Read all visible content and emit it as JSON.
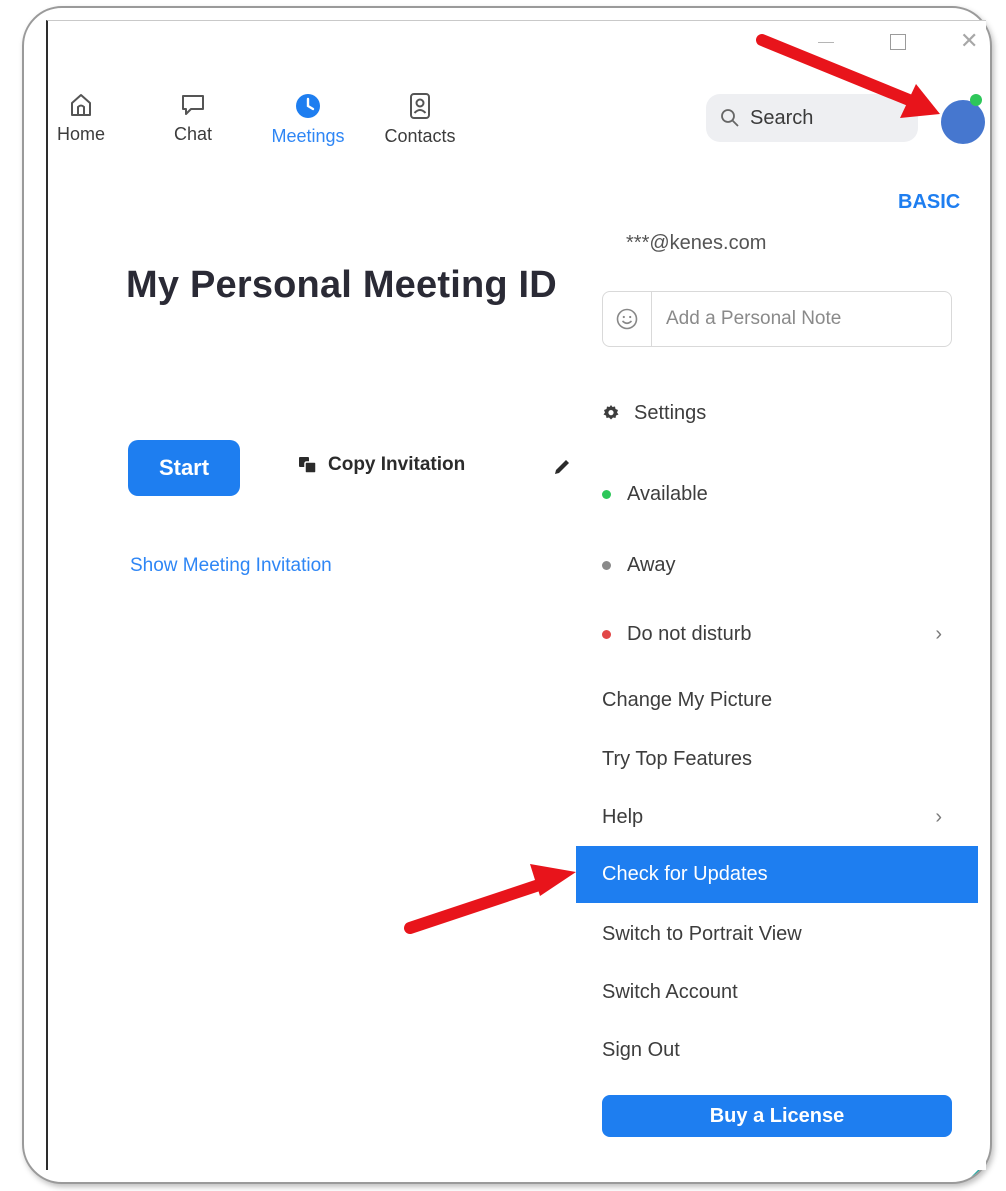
{
  "nav": {
    "home": "Home",
    "chat": "Chat",
    "meetings": "Meetings",
    "contacts": "Contacts"
  },
  "search": {
    "label": "Search"
  },
  "main": {
    "title": "My Personal Meeting ID",
    "start": "Start",
    "copy_invitation": "Copy Invitation",
    "show_invitation": "Show Meeting Invitation"
  },
  "panel": {
    "plan": "BASIC",
    "email": "***@kenes.com",
    "note_placeholder": "Add a Personal Note",
    "items": [
      {
        "label": "Settings",
        "icon": "gear-icon"
      },
      {
        "label": "Available",
        "status_color": "#2ec75a"
      },
      {
        "label": "Away",
        "status_color": "#8a8a8a"
      },
      {
        "label": "Do not disturb",
        "status_color": "#e24848",
        "submenu": true
      },
      {
        "label": "Change My Picture"
      },
      {
        "label": "Try Top Features"
      },
      {
        "label": "Help",
        "submenu": true
      },
      {
        "label": "Check for Updates",
        "highlighted": true
      },
      {
        "label": "Switch to Portrait View"
      },
      {
        "label": "Switch Account"
      },
      {
        "label": "Sign Out"
      }
    ],
    "buy": "Buy a License"
  },
  "colors": {
    "accent": "#1e7ef0",
    "annotation_arrow": "#e8141b"
  }
}
